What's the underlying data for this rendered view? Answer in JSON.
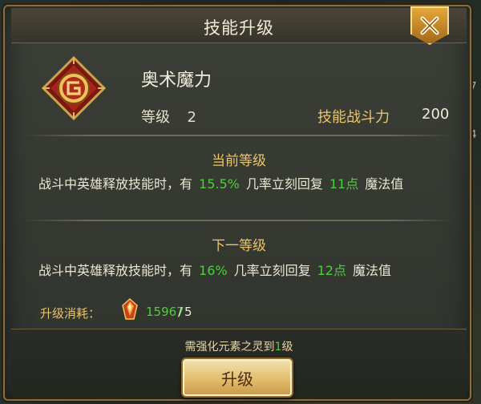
{
  "dialog": {
    "title": "技能升级",
    "close_icon": "close-x-icon"
  },
  "skill": {
    "icon": "skill-emblem-icon",
    "name": "奥术魔力",
    "level_label": "等级",
    "level_value": "2",
    "power_label": "技能战斗力",
    "power_value": "200"
  },
  "current_level": {
    "title": "当前等级",
    "desc_prefix": "战斗中英雄释放技能时，有",
    "chance": "15.5%",
    "desc_mid": "几率立刻回复",
    "amount": "11点",
    "desc_suffix": "魔法值"
  },
  "next_level": {
    "title": "下一等级",
    "desc_prefix": "战斗中英雄释放技能时，有",
    "chance": "16%",
    "desc_mid": "几率立刻回复",
    "amount": "12点",
    "desc_suffix": "魔法值"
  },
  "cost": {
    "label": "升级消耗：",
    "item_icon": "essence-crystal-icon",
    "have": "15967",
    "separator": "/",
    "need": "5"
  },
  "requirement": {
    "prefix": "需强化元素之灵到",
    "level": "1",
    "suffix": "级"
  },
  "upgrade_button": {
    "label": "升级"
  },
  "background": {
    "right_edge_texts": [
      "67",
      "8.",
      "14",
      "9"
    ]
  },
  "colors": {
    "highlight_green": "#4ccf3a",
    "gold_text": "#e9c46a",
    "frame_gold": "#8a6f3c"
  }
}
